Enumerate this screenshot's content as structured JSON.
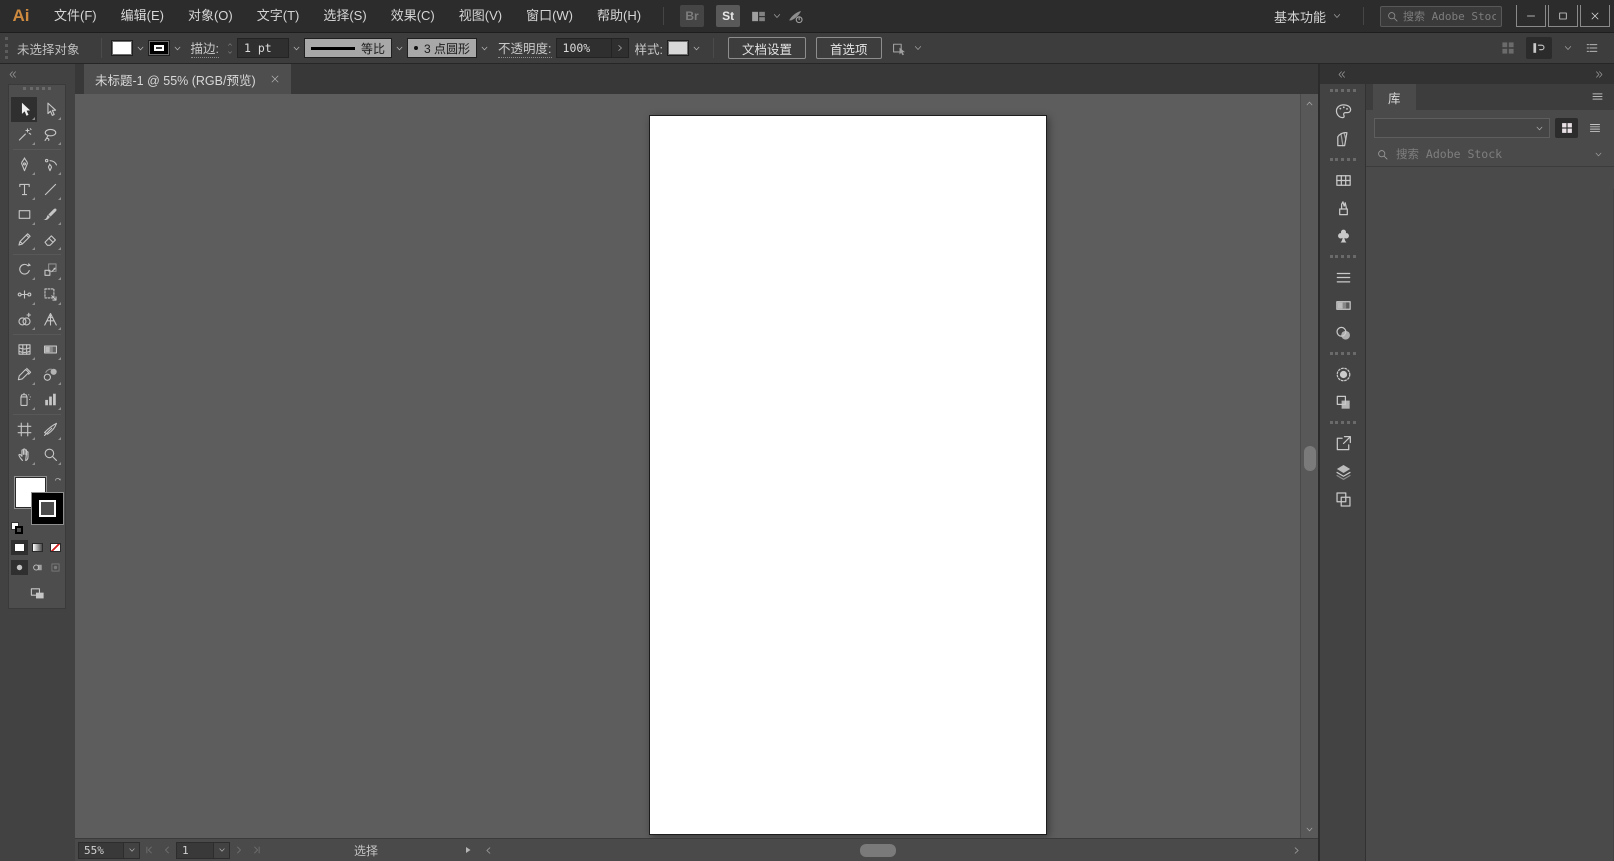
{
  "titlebar": {
    "logo": "Ai",
    "menus": [
      "文件(F)",
      "编辑(E)",
      "对象(O)",
      "文字(T)",
      "选择(S)",
      "效果(C)",
      "视图(V)",
      "窗口(W)",
      "帮助(H)"
    ],
    "bridge_label": "Br",
    "stock_label": "St",
    "workspace": "基本功能",
    "search_placeholder": "搜索 Adobe Stock"
  },
  "controlbar": {
    "selection_status": "未选择对象",
    "stroke_label": "描边:",
    "stroke_weight": "1 pt",
    "variable_width_profile": "等比",
    "brush_definition": "3 点圆形",
    "opacity_label": "不透明度:",
    "opacity_value": "100%",
    "style_label": "样式:",
    "document_setup_button": "文档设置",
    "preferences_button": "首选项"
  },
  "document": {
    "tab_title": "未标题-1 @ 55% (RGB/预览)"
  },
  "tools": {
    "active": "selection",
    "groups": [
      [
        "selection",
        "direct-selection",
        "magic-wand",
        "lasso"
      ],
      [
        "pen",
        "curvature",
        "type",
        "line-segment",
        "rectangle",
        "paintbrush",
        "shaper",
        "eraser"
      ],
      [
        "rotate",
        "scale",
        "width",
        "free-transform",
        "shape-builder",
        "perspective-grid"
      ],
      [
        "mesh",
        "gradient",
        "eyedropper",
        "blend",
        "symbol-sprayer",
        "column-graph"
      ],
      [
        "artboard",
        "slice",
        "hand",
        "zoom"
      ]
    ]
  },
  "statusbar": {
    "zoom": "55%",
    "artboard_number": "1",
    "status_text": "选择"
  },
  "right_dock": {
    "panel_icon_groups": [
      [
        "color",
        "color-guide"
      ],
      [
        "swatches",
        "brushes",
        "symbols"
      ],
      [
        "stroke",
        "gradient",
        "transparency"
      ],
      [
        "appearance",
        "graphic-styles"
      ],
      [
        "asset-export",
        "layers",
        "artboards"
      ]
    ],
    "library": {
      "tab": "库",
      "search_placeholder": "搜索 Adobe Stock"
    }
  },
  "colors": {
    "logo_accent": "#CE8A3F",
    "titlebar_bg": "#2C2C2C",
    "controlbar_bg": "#3D3D3D",
    "panel_bg": "#4A4A4A",
    "canvas_bg": "#5D5D5D",
    "artboard": "#FFFFFF",
    "none_indicator": "#CF1F1F"
  }
}
